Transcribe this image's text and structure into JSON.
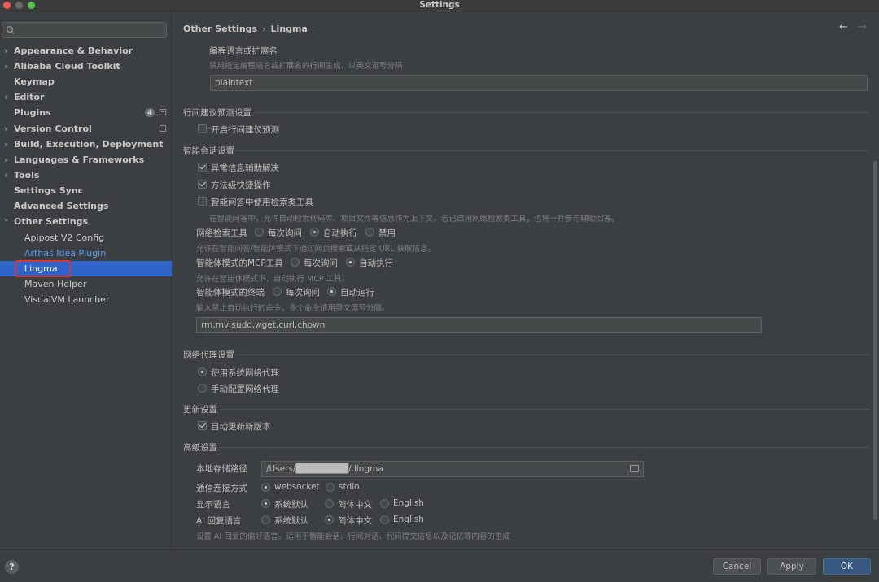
{
  "window": {
    "title": "Settings"
  },
  "colors": {
    "accent": "#2f65ca",
    "link": "#589df6",
    "highlight_box": "#d9383a",
    "primary_button": "#365880"
  },
  "sidebar": {
    "search": {
      "placeholder": "Q▾",
      "value": ""
    },
    "items": [
      {
        "label": "Appearance & Behavior",
        "expandable": true
      },
      {
        "label": "Alibaba Cloud Toolkit",
        "expandable": true
      },
      {
        "label": "Keymap",
        "expandable": false
      },
      {
        "label": "Editor",
        "expandable": true
      },
      {
        "label": "Plugins",
        "expandable": false,
        "badge": "4"
      },
      {
        "label": "Version Control",
        "expandable": true
      },
      {
        "label": "Build, Execution, Deployment",
        "expandable": true
      },
      {
        "label": "Languages & Frameworks",
        "expandable": true
      },
      {
        "label": "Tools",
        "expandable": true
      },
      {
        "label": "Settings Sync",
        "expandable": false
      },
      {
        "label": "Advanced Settings",
        "expandable": false
      },
      {
        "label": "Other Settings",
        "expandable": true,
        "expanded": true
      },
      {
        "label": "Apipost V2 Config",
        "child": true
      },
      {
        "label": "Arthas Idea Plugin",
        "child": true,
        "link": true
      },
      {
        "label": "Lingma",
        "child": true,
        "selected": true
      },
      {
        "label": "Maven Helper",
        "child": true
      },
      {
        "label": "VisualVM Launcher",
        "child": true
      }
    ]
  },
  "breadcrumb": {
    "parent": "Other Settings",
    "sep": "›",
    "current": "Lingma",
    "back": "←",
    "forward": "→"
  },
  "content": {
    "lang_ext": {
      "label": "编程语言或扩展名",
      "hint": "禁用指定编程语言或扩展名的行间生成，以英文逗号分隔",
      "value": "plaintext"
    },
    "inline": {
      "title": "行间建议预测设置",
      "enable_label": "开启行间建议预测",
      "enable_checked": false
    },
    "chat": {
      "title": "智能会话设置",
      "exception_label": "异常信息辅助解决",
      "exception_checked": true,
      "method_label": "方法级快捷操作",
      "method_checked": true,
      "search_tool_label": "智能问答中使用检索类工具",
      "search_tool_checked": false,
      "search_tool_hint": "在智能问答中，允许自动检索代码库、项目文件等信息作为上下文。若已启用网络检索类工具，也将一并参与辅助回答。",
      "web_search": {
        "label": "网络检索工具",
        "options": [
          "每次询问",
          "自动执行",
          "禁用"
        ],
        "selected": 1,
        "hint": "允许在智能问答/智能体模式下通过网页搜索或从指定 URL 获取信息。"
      },
      "mcp": {
        "label": "智能体模式的MCP工具",
        "options": [
          "每次询问",
          "自动执行"
        ],
        "selected": 1,
        "hint": "允许在智能体模式下，自动执行 MCP 工具。"
      },
      "terminal": {
        "label": "智能体模式的终端",
        "options": [
          "每次询问",
          "自动运行"
        ],
        "selected": 1,
        "hint": "输入禁止自动执行的命令，多个命令请用英文逗号分隔。",
        "value": "rm,mv,sudo,wget,curl,chown"
      }
    },
    "proxy": {
      "title": "网络代理设置",
      "options": [
        "使用系统网络代理",
        "手动配置网络代理"
      ],
      "selected": 0
    },
    "update": {
      "title": "更新设置",
      "auto_label": "自动更新新版本",
      "auto_checked": true
    },
    "advanced": {
      "title": "高级设置",
      "storage": {
        "label": "本地存储路径",
        "value": "/Users/████████/.lingma"
      },
      "connection": {
        "label": "通信连接方式",
        "options": [
          "websocket",
          "stdio"
        ],
        "selected": 0
      },
      "display_lang": {
        "label": "显示语言",
        "options": [
          "系统默认",
          "简体中文",
          "English"
        ],
        "selected": 0
      },
      "ai_lang": {
        "label": "AI 回复语言",
        "options": [
          "系统默认",
          "简体中文",
          "English"
        ],
        "selected": 1
      },
      "hint": "设置 AI 回复的偏好语言。适用于智能会话、行间对话、代码提交信息以及记忆等内容的生成"
    }
  },
  "footer": {
    "help": "?",
    "cancel": "Cancel",
    "apply": "Apply",
    "ok": "OK"
  }
}
